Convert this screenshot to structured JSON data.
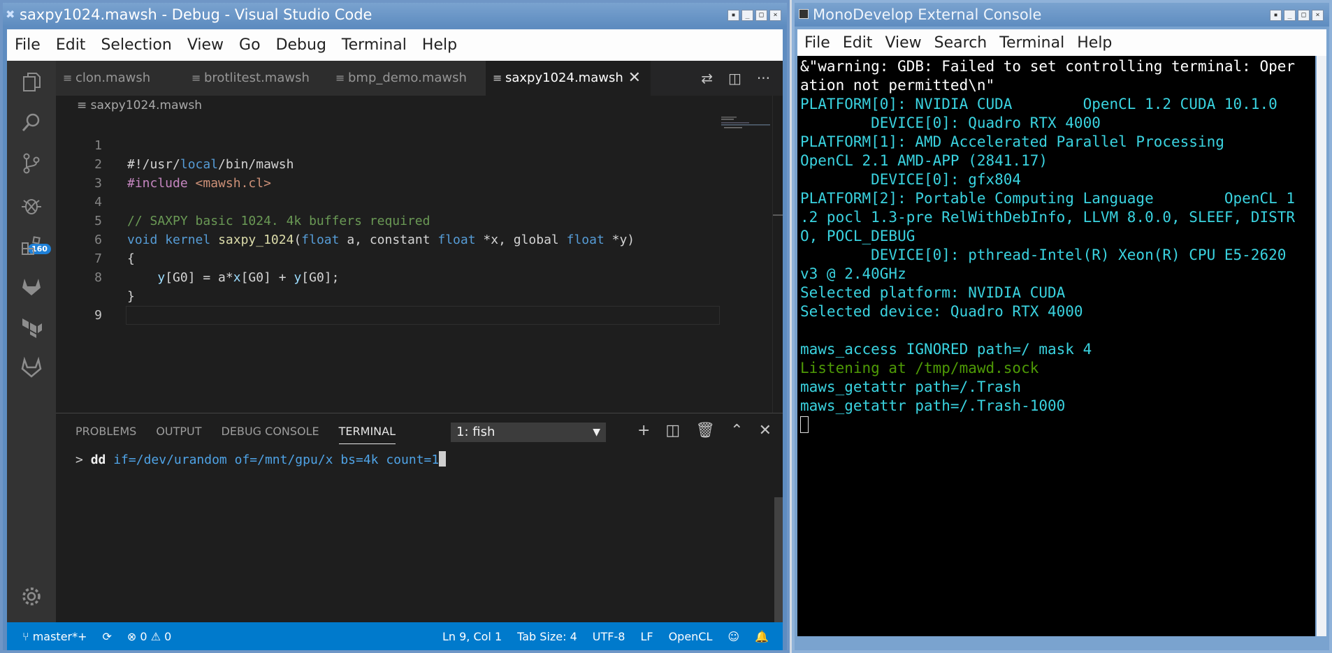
{
  "vscode": {
    "title": "saxpy1024.mawsh - Debug - Visual Studio Code",
    "menu": [
      "File",
      "Edit",
      "Selection",
      "View",
      "Go",
      "Debug",
      "Terminal",
      "Help"
    ],
    "scm_badge": "160",
    "tabs": [
      {
        "label": "clon.mawsh"
      },
      {
        "label": "brotlitest.mawsh"
      },
      {
        "label": "bmp_demo.mawsh"
      },
      {
        "label": "saxpy1024.mawsh"
      }
    ],
    "breadcrumb": "saxpy1024.mawsh",
    "code_lines": [
      {
        "num": "1",
        "text": "#!/usr/local/bin/mawsh"
      },
      {
        "num": "2",
        "text": "#include <mawsh.cl>"
      },
      {
        "num": "3",
        "text": ""
      },
      {
        "num": "4",
        "text": "// SAXPY basic 1024. 4k buffers required"
      },
      {
        "num": "5",
        "text": "void kernel saxpy_1024(float a, constant float *x, global float *y)"
      },
      {
        "num": "6",
        "text": "{"
      },
      {
        "num": "7",
        "text": "    y[G0] = a*x[G0] + y[G0];"
      },
      {
        "num": "8",
        "text": "}"
      },
      {
        "num": "9",
        "text": ""
      }
    ],
    "panel": {
      "tabs": [
        "PROBLEMS",
        "OUTPUT",
        "DEBUG CONSOLE",
        "TERMINAL"
      ],
      "terminal_select": "1: fish",
      "prompt": ">",
      "command": "dd",
      "args": "if=/dev/urandom of=/mnt/gpu/x bs=4k count=1"
    },
    "status": {
      "branch": "master*+",
      "errors": "0",
      "warnings": "0",
      "position": "Ln 9, Col 1",
      "tab_size": "Tab Size: 4",
      "encoding": "UTF-8",
      "eol": "LF",
      "language": "OpenCL"
    },
    "colors": {
      "statusbar": "#007acc",
      "editor_bg": "#1e1e1e",
      "keyword": "#569cd6",
      "comment": "#6a9955",
      "string": "#ce9178"
    }
  },
  "mono": {
    "title": "MonoDevelop External Console",
    "menu": [
      "File",
      "Edit",
      "View",
      "Search",
      "Terminal",
      "Help"
    ],
    "lines": [
      {
        "text": "&\"warning: GDB: Failed to set controlling terminal: Oper",
        "color": "#ffffff"
      },
      {
        "text": "ation not permitted\\n\"",
        "color": "#ffffff"
      },
      {
        "text": "PLATFORM[0]: NVIDIA CUDA        OpenCL 1.2 CUDA 10.1.0",
        "color": "#3ad3e0"
      },
      {
        "text": "        DEVICE[0]: Quadro RTX 4000",
        "color": "#3ad3e0"
      },
      {
        "text": "PLATFORM[1]: AMD Accelerated Parallel Processing",
        "color": "#3ad3e0"
      },
      {
        "text": "OpenCL 2.1 AMD-APP (2841.17)",
        "color": "#3ad3e0"
      },
      {
        "text": "        DEVICE[0]: gfx804",
        "color": "#3ad3e0"
      },
      {
        "text": "PLATFORM[2]: Portable Computing Language        OpenCL 1",
        "color": "#3ad3e0"
      },
      {
        "text": ".2 pocl 1.3-pre RelWithDebInfo, LLVM 8.0.0, SLEEF, DISTR",
        "color": "#3ad3e0"
      },
      {
        "text": "O, POCL_DEBUG",
        "color": "#3ad3e0"
      },
      {
        "text": "        DEVICE[0]: pthread-Intel(R) Xeon(R) CPU E5-2620",
        "color": "#3ad3e0"
      },
      {
        "text": "v3 @ 2.40GHz",
        "color": "#3ad3e0"
      },
      {
        "text": "Selected platform: NVIDIA CUDA",
        "color": "#3ad3e0"
      },
      {
        "text": "Selected device: Quadro RTX 4000",
        "color": "#3ad3e0"
      },
      {
        "text": "",
        "color": "#3ad3e0"
      },
      {
        "text": "maws_access IGNORED path=/ mask 4",
        "color": "#3ad3e0"
      },
      {
        "text": "Listening at /tmp/mawd.sock",
        "color": "#4e9a06"
      },
      {
        "text": "maws_getattr path=/.Trash",
        "color": "#3ad3e0"
      },
      {
        "text": "maws_getattr path=/.Trash-1000",
        "color": "#3ad3e0"
      }
    ]
  }
}
